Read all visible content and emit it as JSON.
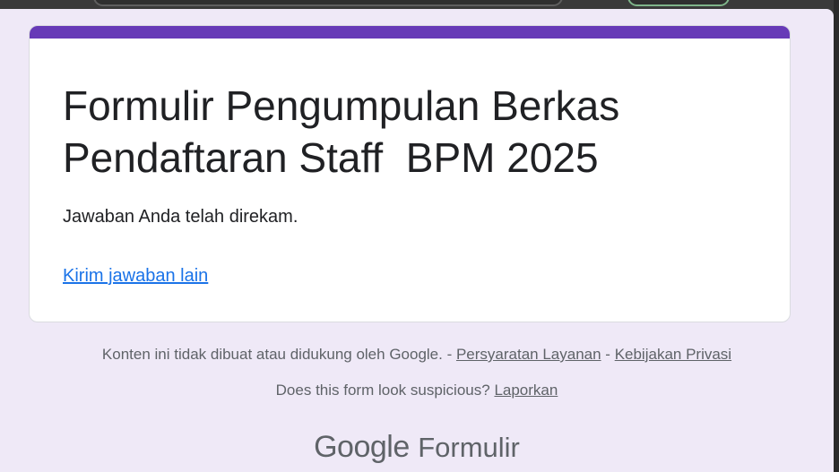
{
  "colors": {
    "accent": "#673ab7",
    "link": "#1a73e8",
    "page_background": "#efe9f7"
  },
  "form": {
    "title": "Formulir Pengumpulan Berkas\nPendaftaran Staff  BPM 2025",
    "confirmation": "Jawaban Anda telah direkam.",
    "submit_another_link": "Kirim jawaban lain"
  },
  "footer": {
    "disclaimer_text": "Konten ini tidak dibuat atau didukung oleh Google.",
    "separator": " - ",
    "terms_link": "Persyaratan Layanan",
    "privacy_link": "Kebijakan Privasi",
    "suspicious_text": "Does this form look suspicious?",
    "report_link": "Laporkan"
  },
  "brand": {
    "company": "Google",
    "product": "Formulir"
  }
}
